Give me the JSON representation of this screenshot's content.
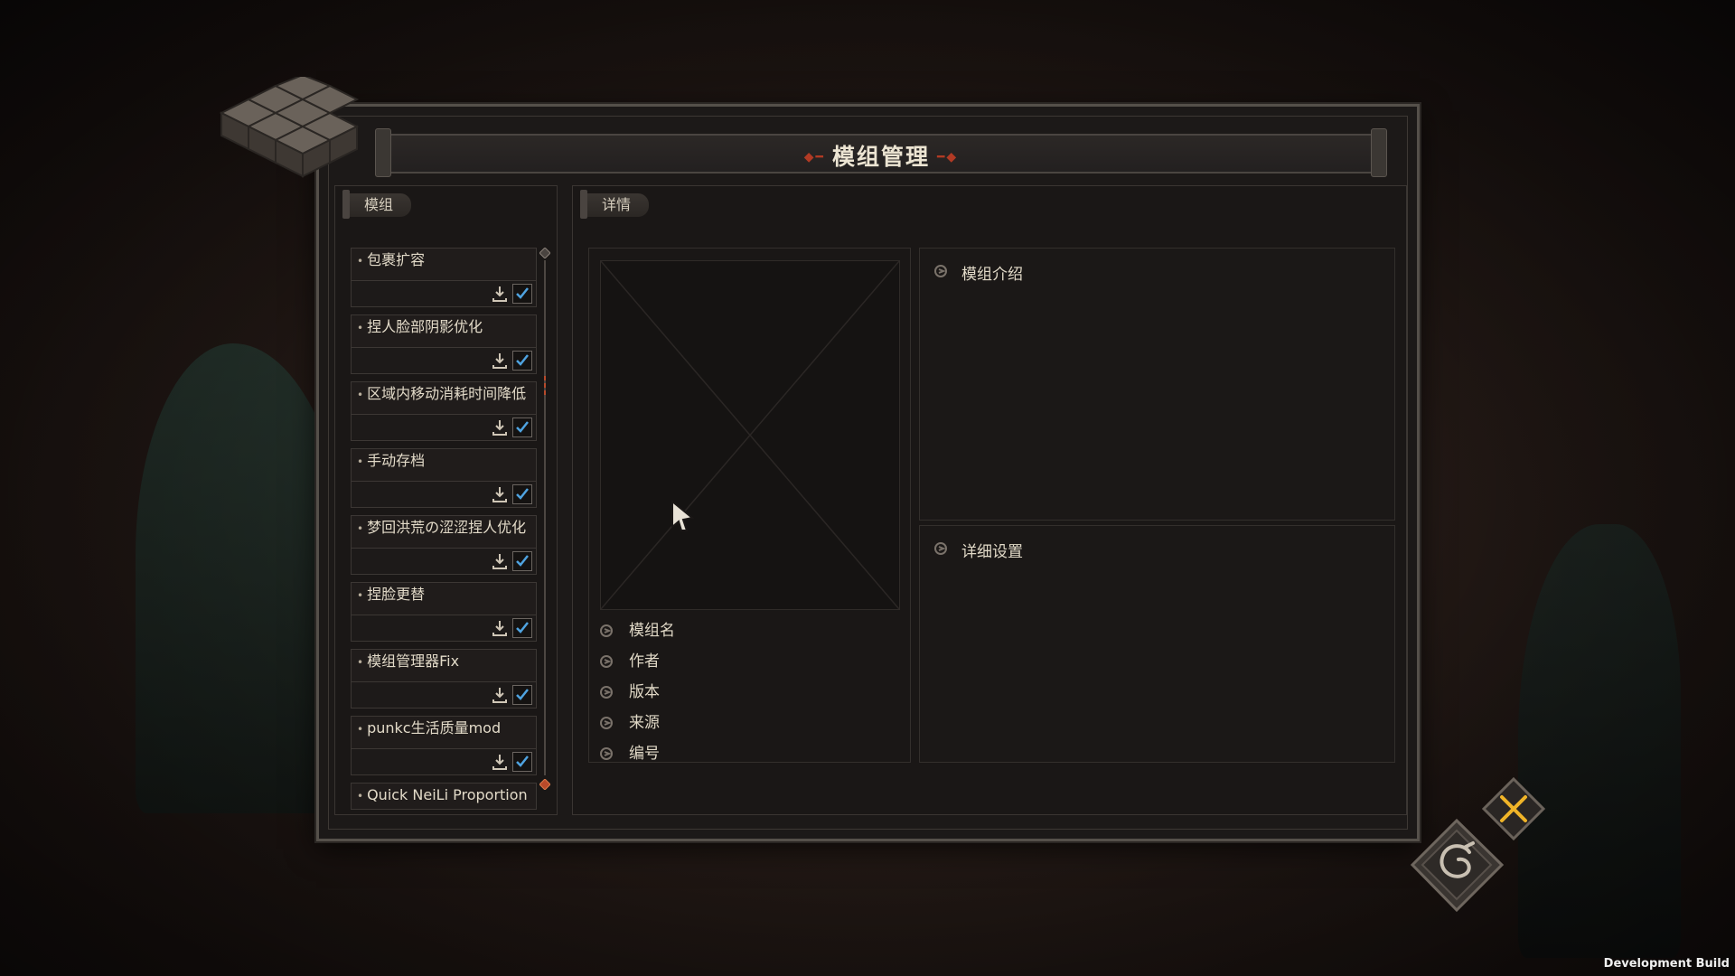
{
  "window": {
    "title": "模组管理"
  },
  "left_panel": {
    "tab_label": "模组"
  },
  "right_panel": {
    "tab_label": "详情"
  },
  "mods": [
    {
      "name": "包裹扩容",
      "enabled": true
    },
    {
      "name": "捏人脸部阴影优化",
      "enabled": true
    },
    {
      "name": "区域内移动消耗时间降低",
      "enabled": true
    },
    {
      "name": "手动存档",
      "enabled": true
    },
    {
      "name": "梦回洪荒の涩涩捏人优化",
      "enabled": true
    },
    {
      "name": "捏脸更替",
      "enabled": true
    },
    {
      "name": "模组管理器Fix",
      "enabled": true
    },
    {
      "name": "punkc生活质量mod",
      "enabled": true
    },
    {
      "name": "Quick NeiLi Proportion",
      "enabled": true
    }
  ],
  "details": {
    "fields": {
      "mod_name": "模组名",
      "author": "作者",
      "version": "版本",
      "source": "来源",
      "id": "编号"
    },
    "description_heading": "模组介绍",
    "settings_heading": "详细设置"
  },
  "status": {
    "build_label": "Development Build"
  },
  "icons": {
    "download": "download-icon",
    "check": "checkmark-icon",
    "close": "close-icon",
    "dragon": "dragon-emblem-icon",
    "field_marker": "brush-marker-icon"
  },
  "colors": {
    "accent_red": "#b13a24",
    "check_blue": "#4fa3e0",
    "close_gold": "#f0b428"
  }
}
